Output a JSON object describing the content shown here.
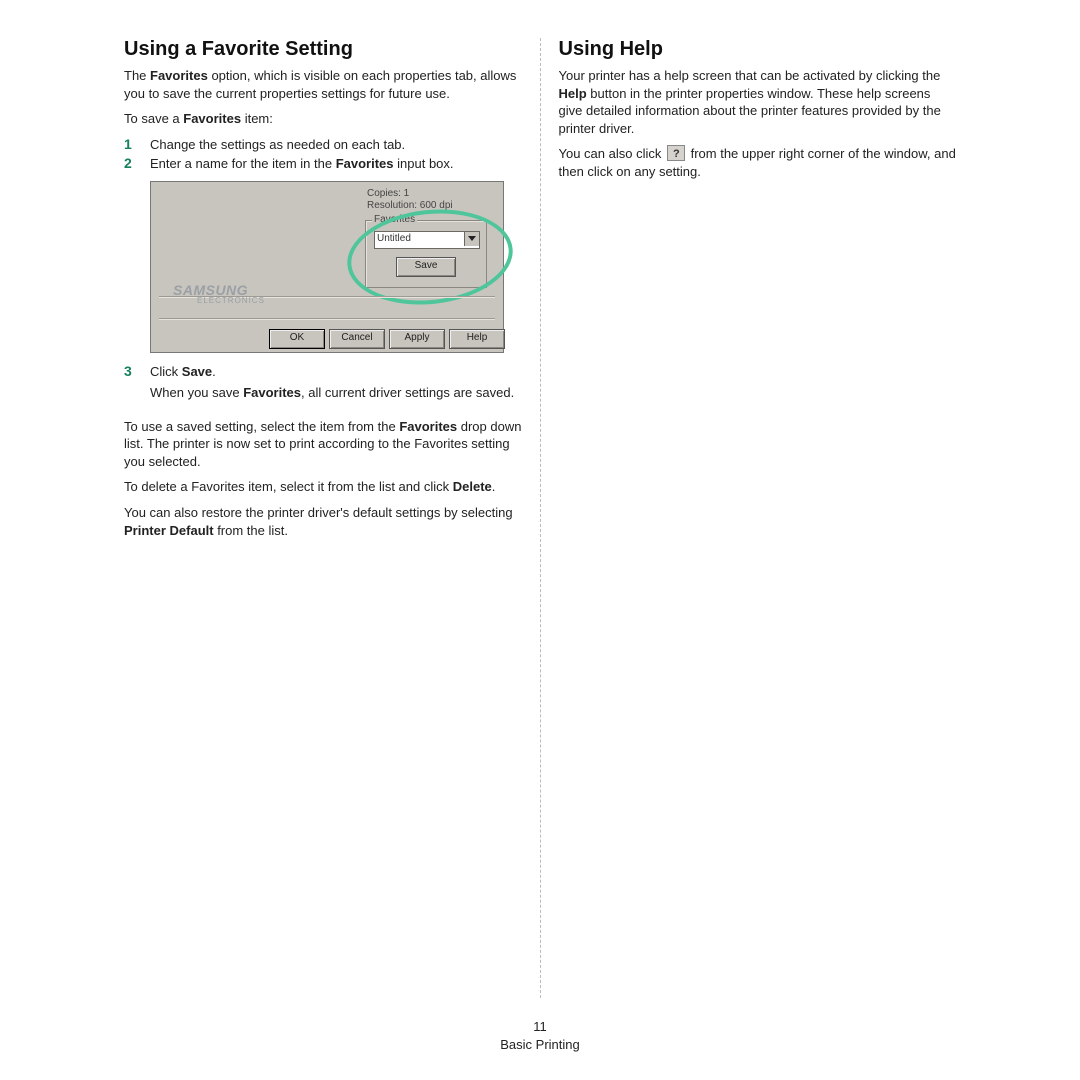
{
  "left": {
    "heading": "Using a Favorite Setting",
    "p_intro_pre": "The ",
    "p_intro_b1": "Favorites",
    "p_intro_post": " option, which is visible on each properties tab, allows you to save the current properties settings for future use.",
    "p_tosave_pre": "To save a ",
    "p_tosave_b": "Favorites",
    "p_tosave_post": " item:",
    "steps": {
      "s1": "Change the settings as needed on each tab.",
      "s2_pre": "Enter a name for the item in the ",
      "s2_b": "Favorites",
      "s2_post": " input box.",
      "s3_pre": "Click ",
      "s3_b": "Save",
      "s3_post": ".",
      "s3_p_pre": "When you save ",
      "s3_p_b": "Favorites",
      "s3_p_post": ", all current driver settings are saved."
    },
    "num1": "1",
    "num2": "2",
    "num3": "3",
    "p_touse_pre": "To use a saved setting, select the item from the ",
    "p_touse_b": "Favorites",
    "p_touse_post": " drop down list. The printer is now set to print according to the Favorites setting you selected.",
    "p_delete_pre": "To delete a Favorites item, select it from the list and click ",
    "p_delete_b": "Delete",
    "p_delete_post": ".",
    "p_default_pre": "You can also restore the printer driver's default settings by selecting ",
    "p_default_b": "Printer Default",
    "p_default_post": " from the list."
  },
  "right": {
    "heading": "Using Help",
    "p1_pre": "Your printer has a help screen that can be activated by clicking the ",
    "p1_b": "Help",
    "p1_post": " button in the printer properties window. These help screens give detailed information about the printer features provided by the printer driver.",
    "p2_pre": "You can also click ",
    "p2_post": " from the upper right corner of the window, and then click on any setting."
  },
  "dialog": {
    "copies": "Copies: 1",
    "resolution": "Resolution: 600 dpi",
    "fav_legend": "Favorites",
    "fav_value": "Untitled",
    "save": "Save",
    "brand": "SAMSUNG",
    "brand_sub": "ELECTRONICS",
    "ok": "OK",
    "cancel": "Cancel",
    "apply": "Apply",
    "help": "Help"
  },
  "footer": {
    "page_num": "11",
    "section": "Basic Printing"
  }
}
